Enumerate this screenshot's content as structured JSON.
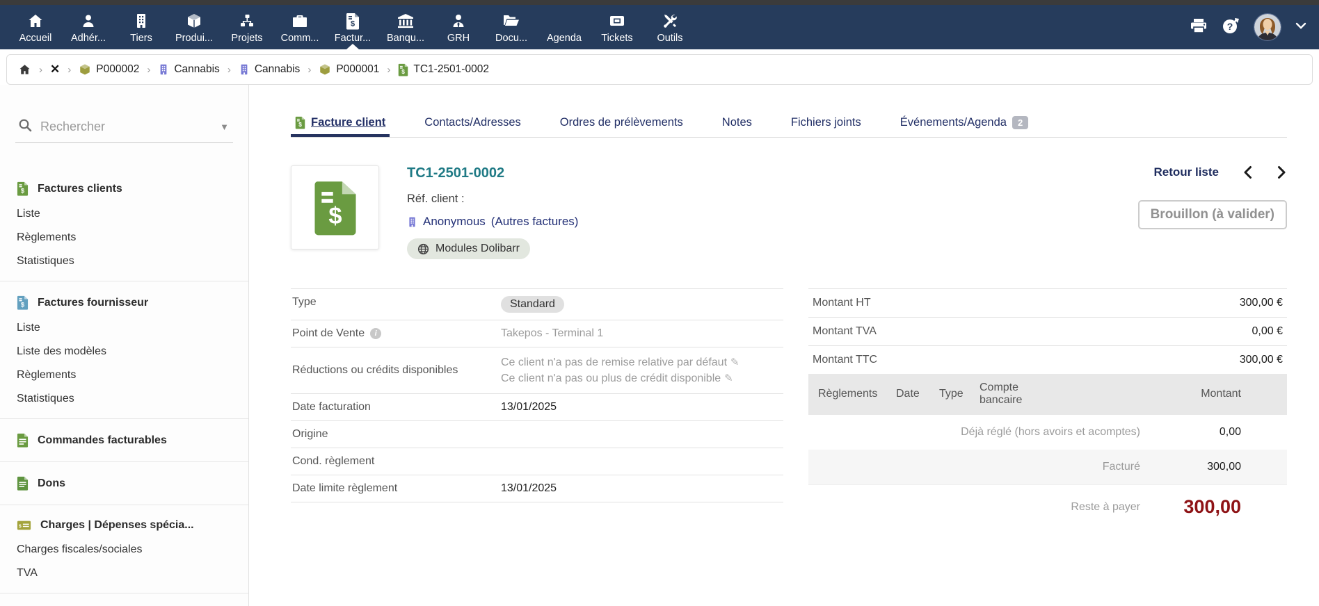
{
  "topnav": {
    "items": [
      {
        "label": "Accueil",
        "icon": "home-icon",
        "active": false
      },
      {
        "label": "Adhér...",
        "icon": "member-icon",
        "active": false
      },
      {
        "label": "Tiers",
        "icon": "thirdparty-building-icon",
        "active": false
      },
      {
        "label": "Produi...",
        "icon": "products-cube-icon",
        "active": false
      },
      {
        "label": "Projets",
        "icon": "projects-icon",
        "active": false
      },
      {
        "label": "Comm...",
        "icon": "commerce-briefcase-icon",
        "active": false
      },
      {
        "label": "Factur...",
        "icon": "billing-invoice-icon",
        "active": true
      },
      {
        "label": "Banqu...",
        "icon": "bank-icon",
        "active": false
      },
      {
        "label": "GRH",
        "icon": "hrm-user-tie-icon",
        "active": false
      },
      {
        "label": "Docu...",
        "icon": "documents-folder-icon",
        "active": false
      },
      {
        "label": "Agenda",
        "icon": "",
        "active": false
      },
      {
        "label": "Tickets",
        "icon": "tickets-icon",
        "active": false
      },
      {
        "label": "Outils",
        "icon": "tools-icon",
        "active": false
      }
    ]
  },
  "breadcrumb": {
    "items": [
      {
        "label": "P000002"
      },
      {
        "label": "Cannabis"
      },
      {
        "label": "Cannabis"
      },
      {
        "label": "P000001"
      },
      {
        "label": "TC1-2501-0002"
      }
    ]
  },
  "sidebar": {
    "search_placeholder": "Rechercher",
    "sections": [
      {
        "title": "Factures clients",
        "items": [
          "Liste",
          "Règlements",
          "Statistiques"
        ]
      },
      {
        "title": "Factures fournisseur",
        "items": [
          "Liste",
          "Liste des modèles",
          "Règlements",
          "Statistiques"
        ]
      },
      {
        "title": "Commandes facturables",
        "items": []
      },
      {
        "title": "Dons",
        "items": []
      },
      {
        "title": "Charges | Dépenses spécia...",
        "items": [
          "Charges fiscales/sociales",
          "TVA"
        ]
      }
    ]
  },
  "tabs": [
    {
      "label": "Facture client"
    },
    {
      "label": "Contacts/Adresses"
    },
    {
      "label": "Ordres de prélèvements"
    },
    {
      "label": "Notes"
    },
    {
      "label": "Fichiers joints"
    },
    {
      "label": "Événements/Agenda",
      "badge": "2"
    }
  ],
  "header": {
    "title": "TC1-2501-0002",
    "ref_client_label": "Réf. client :",
    "company": "Anonymous",
    "company_suffix": "(Autres factures)",
    "project_badge": "Modules Dolibarr",
    "back_to_list": "Retour liste",
    "status": "Brouillon (à valider)"
  },
  "details": {
    "rows": [
      {
        "label": "Type",
        "value": "Standard"
      },
      {
        "label": "Point de Vente",
        "value": "Takepos - Terminal 1"
      },
      {
        "label": "Réductions ou crédits disponibles",
        "line1": "Ce client n'a pas de remise relative par défaut",
        "line2": "Ce client n'a pas ou plus de crédit disponible"
      },
      {
        "label": "Date facturation",
        "value": "13/01/2025"
      },
      {
        "label": "Origine",
        "value": ""
      },
      {
        "label": "Cond. règlement",
        "value": ""
      },
      {
        "label": "Date limite règlement",
        "value": "13/01/2025"
      }
    ]
  },
  "amounts": {
    "rows": [
      {
        "label": "Montant HT",
        "value": "300,00 €"
      },
      {
        "label": "Montant TVA",
        "value": "0,00 €"
      },
      {
        "label": "Montant TTC",
        "value": "300,00 €"
      }
    ]
  },
  "payments": {
    "headers": [
      "Règlements",
      "Date",
      "Type",
      "Compte bancaire",
      "Montant"
    ],
    "summary": [
      {
        "label": "Déjà réglé (hors avoirs et acomptes)",
        "value": "0,00"
      },
      {
        "label": "Facturé",
        "value": "300,00"
      },
      {
        "label": "Reste à payer",
        "value": "300,00"
      }
    ]
  },
  "colors": {
    "topnav": "#263c5c",
    "title_teal": "#1f7a85",
    "link_navy": "#222f66",
    "remain_red": "#8e1316",
    "invoice_green": "#6a9b41",
    "supplier_blue": "#63a0bf",
    "cube_olive": "#9d9d3f",
    "building_purple": "#7678d4"
  }
}
